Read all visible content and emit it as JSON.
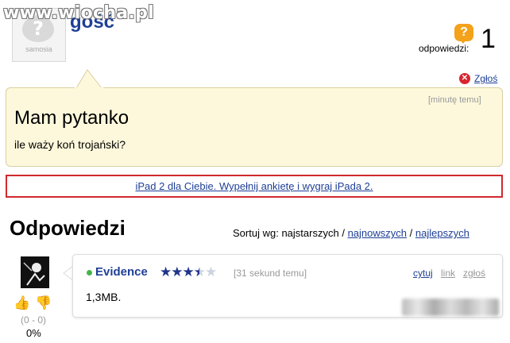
{
  "watermark": "www.wiocha.pl",
  "header": {
    "avatar_caption": "samosia",
    "avatar_glyph": "?",
    "author": "gość",
    "answers_label": "odpowiedzi:",
    "answers_count": "1",
    "question_icon_glyph": "?",
    "report_label": "Zgłoś"
  },
  "question": {
    "time": "[minutę temu]",
    "title": "Mam pytanko",
    "body": "ile waży koń trojański?"
  },
  "ad": {
    "text": "iPad 2 dla Ciebie. Wypełnij ankietę i wygraj iPada 2."
  },
  "answers_section": {
    "heading": "Odpowiedzi",
    "sort_label": "Sortuj wg:",
    "sort_current": "najstarszych",
    "sort_options": [
      "najnowszych",
      "najlepszych"
    ],
    "separator": "/"
  },
  "answer": {
    "author": "Evidence",
    "rating_stars": 3.5,
    "rating_max": 5,
    "time": "[31 sekund temu]",
    "actions": {
      "quote": "cytuj",
      "link": "link",
      "report": "zgłoś"
    },
    "body": "1,3MB.",
    "votes": {
      "score": "(0 - 0)",
      "percent": "0%"
    }
  },
  "colors": {
    "link": "#1e3f96",
    "question_bg": "#fdf8dc",
    "ad_border": "#d0292e",
    "badge_orange": "#f3a21a",
    "star": "#20358a",
    "online": "#45b54a"
  },
  "icons": {
    "answers": "question-bubble-icon",
    "report": "close-circle-icon",
    "vote_up": "thumbs-up-icon",
    "vote_down": "thumbs-down-icon"
  }
}
